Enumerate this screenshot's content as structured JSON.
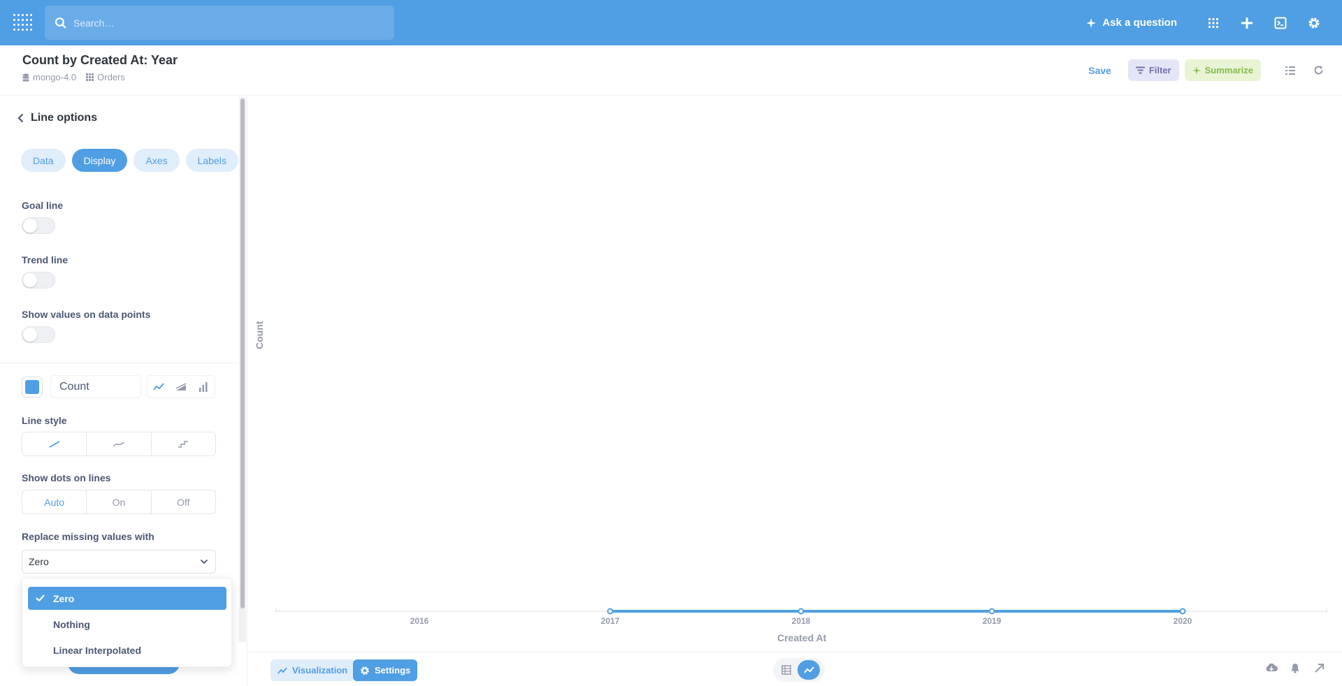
{
  "colors": {
    "brand": "#509ee3",
    "filter": "#7172ad",
    "summarize": "#84bb4c"
  },
  "nav": {
    "search_placeholder": "Search…",
    "ask_label": "Ask a question",
    "icons": [
      "grid-icon",
      "plus-icon",
      "sql-editor-icon",
      "gear-icon"
    ]
  },
  "header": {
    "title": "Count by Created At: Year",
    "database": "mongo-4.0",
    "table": "Orders",
    "save_label": "Save",
    "filter_label": "Filter",
    "summarize_label": "Summarize"
  },
  "sidebar": {
    "back_label": "Line options",
    "tabs": [
      {
        "label": "Data"
      },
      {
        "label": "Display"
      },
      {
        "label": "Axes"
      },
      {
        "label": "Labels"
      }
    ],
    "active_tab": "Display",
    "goal_line_label": "Goal line",
    "trend_line_label": "Trend line",
    "show_values_label": "Show values on data points",
    "goal_line_on": false,
    "trend_line_on": false,
    "show_values_on": false,
    "series_name": "Count",
    "series_color": "#509ee3",
    "line_style_label": "Line style",
    "show_dots_label": "Show dots on lines",
    "dots_options": [
      "Auto",
      "On",
      "Off"
    ],
    "dots_selected": "Auto",
    "replace_missing_label": "Replace missing values with",
    "replace_missing_value": "Zero"
  },
  "dropdown": {
    "options": [
      "Zero",
      "Nothing",
      "Linear Interpolated"
    ],
    "selected": "Zero"
  },
  "chart_data": {
    "type": "line",
    "x": [
      "2016",
      "2017",
      "2018",
      "2019",
      "2020"
    ],
    "tick_labels": [
      "2016",
      "2017",
      "2018",
      "2019",
      "2020"
    ],
    "series": [
      {
        "values": [
          null,
          0,
          0,
          0,
          0
        ]
      }
    ],
    "xlabel": "Created At",
    "ylabel": "Count",
    "grid": false
  },
  "footer": {
    "visualization_label": "Visualization",
    "settings_label": "Settings"
  }
}
